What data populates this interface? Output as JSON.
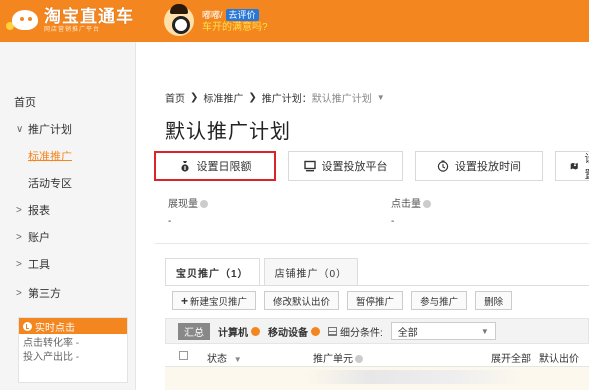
{
  "header": {
    "logo_title": "淘宝直通车",
    "logo_sub": "网店营销推广平台",
    "promo_greeting": "嘟嘟/",
    "promo_badge": "去评价",
    "promo_question": "车开的满意吗?"
  },
  "sidebar": {
    "items": [
      {
        "label": "首页"
      },
      {
        "label": "推广计划",
        "chevron": "∨"
      },
      {
        "label": "标准推广",
        "active": true
      },
      {
        "label": "活动专区"
      },
      {
        "label": "报表",
        "chevron": ">"
      },
      {
        "label": "账户",
        "chevron": ">"
      },
      {
        "label": "工具",
        "chevron": ">"
      },
      {
        "label": "第三方",
        "chevron": ">"
      }
    ],
    "realtime": {
      "title": "实时点击",
      "rows": [
        "点击转化率 -",
        "投入产出比 -"
      ]
    }
  },
  "breadcrumb": {
    "home": "首页",
    "level2": "标准推广",
    "current_label": "推广计划：",
    "current_value": "默认推广计划"
  },
  "page_title": "默认推广计划",
  "toolbar": {
    "buttons": [
      {
        "label": "设置日限额",
        "icon": "money-bag-icon"
      },
      {
        "label": "设置投放平台",
        "icon": "monitor-icon"
      },
      {
        "label": "设置投放时间",
        "icon": "clock-icon"
      },
      {
        "label": "设置",
        "icon": "map-pin-icon"
      }
    ]
  },
  "metrics": {
    "impressions_label": "展现量",
    "impressions_value": "-",
    "clicks_label": "点击量",
    "clicks_value": "-"
  },
  "tabs": [
    {
      "label": "宝贝推广（1）",
      "active": true
    },
    {
      "label": "店铺推广（0）",
      "active": false
    }
  ],
  "actions": {
    "new_item": "新建宝贝推广",
    "modify_bid": "修改默认出价",
    "pause": "暂停推广",
    "join": "参与推广",
    "delete": "删除"
  },
  "filterbar": {
    "summary": "汇总",
    "computer": "计算机",
    "mobile": "移动设备",
    "detail_label": "细分条件:",
    "detail_value": "全部"
  },
  "table": {
    "col_status": "状态",
    "col_unit": "推广单元",
    "col_expand": "展开全部",
    "col_bid": "默认出价"
  },
  "colors": {
    "accent": "#f4861f",
    "highlight_border": "#d9242a"
  }
}
